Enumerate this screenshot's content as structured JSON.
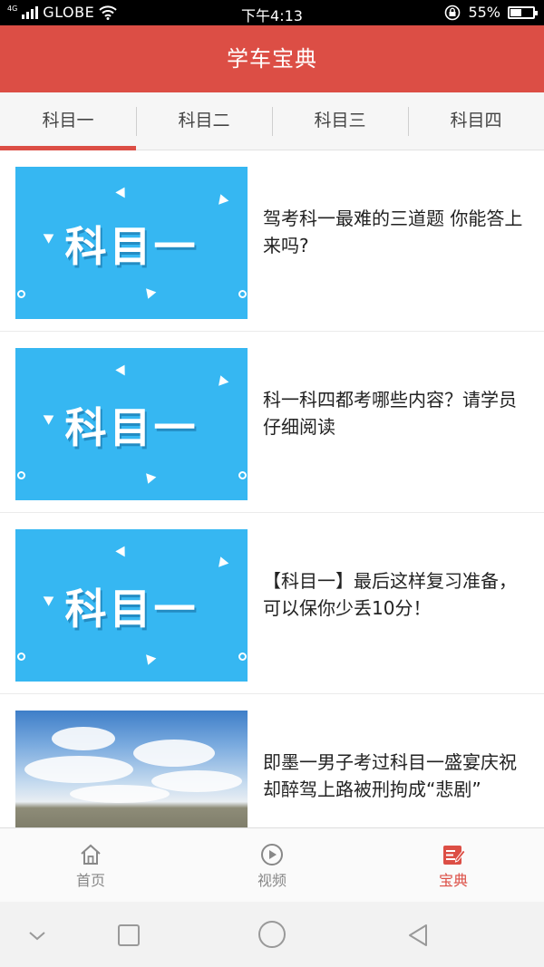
{
  "status_bar": {
    "network": "4G",
    "carrier": "GLOBE",
    "time": "下午4:13",
    "battery": "55%",
    "battery_level": 0.55
  },
  "header": {
    "title": "学车宝典"
  },
  "tabs": [
    {
      "label": "科目一",
      "active": true
    },
    {
      "label": "科目二",
      "active": false
    },
    {
      "label": "科目三",
      "active": false
    },
    {
      "label": "科目四",
      "active": false
    }
  ],
  "articles": [
    {
      "thumb_text": "科目一",
      "title": "驾考科一最难的三道题 你能答上来吗?"
    },
    {
      "thumb_text": "科目一",
      "title": "科一科四都考哪些内容？请学员仔细阅读"
    },
    {
      "thumb_text": "科目一",
      "title": "【科目一】最后这样复习准备，可以保你少丢10分！"
    },
    {
      "thumb_text": "",
      "title": "即墨一男子考过科目一盛宴庆祝却醉驾上路被刑拘成“悲剧”"
    }
  ],
  "bottom_nav": [
    {
      "label": "首页",
      "icon": "home-icon",
      "active": false
    },
    {
      "label": "视频",
      "icon": "play-icon",
      "active": false
    },
    {
      "label": "宝典",
      "icon": "notebook-edit-icon",
      "active": true
    }
  ],
  "colors": {
    "brand": "#dc4e45",
    "thumb_blue": "#36b7f2"
  }
}
